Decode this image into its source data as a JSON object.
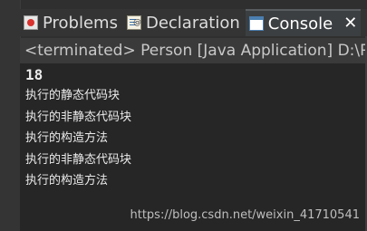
{
  "tabs": [
    {
      "label": "Problems",
      "icon": "problems-icon"
    },
    {
      "label": "Declaration",
      "icon": "declaration-icon"
    },
    {
      "label": "Console",
      "icon": "console-icon",
      "close": "✕"
    }
  ],
  "status_line": "<terminated> Person [Java Application] D:\\Pr",
  "output_lines": [
    "18",
    "执行的静态代码块",
    "执行的非静态代码块",
    "执行的构造方法",
    "执行的非静态代码块",
    "执行的构造方法"
  ],
  "watermark": "https://blog.csdn.net/weixin_41710541"
}
